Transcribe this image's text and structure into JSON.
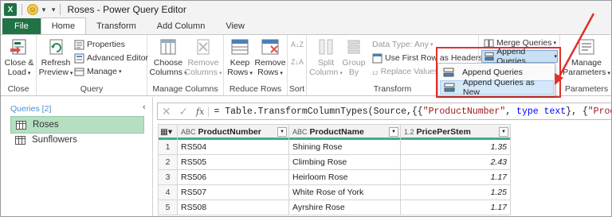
{
  "titlebar": {
    "app_icon": "X",
    "title": "Roses - Power Query Editor"
  },
  "tabs": [
    {
      "label": "File"
    },
    {
      "label": "Home"
    },
    {
      "label": "Transform"
    },
    {
      "label": "Add Column"
    },
    {
      "label": "View"
    }
  ],
  "ribbon": {
    "close": {
      "btn": [
        "Close &",
        "Load"
      ],
      "group": "Close"
    },
    "query": {
      "refresh": [
        "Refresh",
        "Preview"
      ],
      "properties": "Properties",
      "advanced_editor": "Advanced Editor",
      "manage": "Manage",
      "group": "Query"
    },
    "manage_columns": {
      "choose": [
        "Choose",
        "Columns"
      ],
      "remove": [
        "Remove",
        "Columns"
      ],
      "group": "Manage Columns"
    },
    "reduce_rows": {
      "keep": [
        "Keep",
        "Rows"
      ],
      "remove": [
        "Remove",
        "Rows"
      ],
      "group": "Reduce Rows"
    },
    "sort": {
      "group": "Sort"
    },
    "transform": {
      "split": [
        "Split",
        "Column"
      ],
      "groupby": [
        "Group",
        "By"
      ],
      "data_type": "Data Type: Any",
      "first_row": "Use First Row as Headers",
      "replace": "Replace Values",
      "group": "Transform"
    },
    "combine": {
      "merge": "Merge Queries",
      "append": "Append Queries"
    },
    "parameters": {
      "manage": [
        "Manage",
        "Parameters"
      ],
      "group": "Parameters"
    }
  },
  "append_menu": {
    "items": [
      "Append Queries",
      "Append Queries as New"
    ]
  },
  "formula": {
    "prefix": "= Table.TransformColumnTypes(Source,{{",
    "s1": "\"ProductNumber\"",
    "mid": ", ",
    "kw": "type text",
    "mid2": "}, {",
    "s2": "\"ProductName\""
  },
  "queries": {
    "header": "Queries [2]",
    "items": [
      "Roses",
      "Sunflowers"
    ]
  },
  "table": {
    "columns": [
      {
        "type": "ABC",
        "name": "ProductNumber"
      },
      {
        "type": "ABC",
        "name": "ProductName"
      },
      {
        "type": "1.2",
        "name": "PricePerStem"
      }
    ],
    "rows": [
      {
        "n": "1",
        "num": "RS504",
        "name": "Shining Rose",
        "price": "1.35"
      },
      {
        "n": "2",
        "num": "RS505",
        "name": "Climbing Rose",
        "price": "2.43"
      },
      {
        "n": "3",
        "num": "RS506",
        "name": "Heirloom Rose",
        "price": "1.17"
      },
      {
        "n": "4",
        "num": "RS507",
        "name": "White Rose of York",
        "price": "1.25"
      },
      {
        "n": "5",
        "num": "RS508",
        "name": "Ayrshire Rose",
        "price": "1.17"
      }
    ]
  },
  "colors": {
    "excel_green": "#217346",
    "selected_query": "#b5dfc0",
    "highlight_red": "#e0312b",
    "header_bar": "#3fb183"
  }
}
